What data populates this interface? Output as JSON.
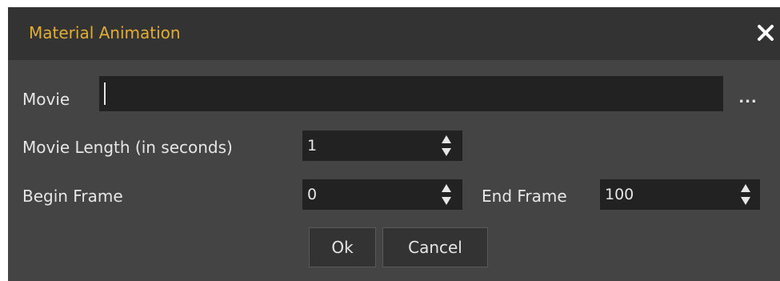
{
  "dialog": {
    "title": "Material Animation",
    "close_icon": "close-icon"
  },
  "movie": {
    "label": "Movie",
    "value": "",
    "browse_label": "..."
  },
  "movie_length": {
    "label": "Movie Length (in seconds)",
    "value": "1"
  },
  "begin_frame": {
    "label": "Begin Frame",
    "value": "0"
  },
  "end_frame": {
    "label": "End Frame",
    "value": "100"
  },
  "buttons": {
    "ok_label": "Ok",
    "cancel_label": "Cancel"
  },
  "colors": {
    "title_accent": "#e3ac33",
    "dialog_bg": "#444444",
    "titlebar_bg": "#333333",
    "field_bg": "#222222",
    "text": "#e6e6e6"
  }
}
